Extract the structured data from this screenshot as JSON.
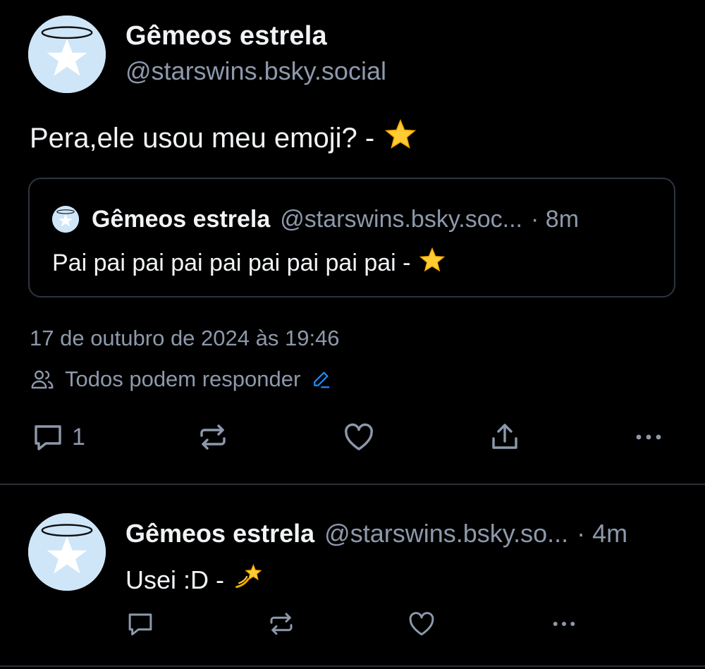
{
  "post": {
    "author_name": "Gêmeos estrela",
    "author_handle": "@starswins.bsky.social",
    "text": "Pera,ele usou meu emoji? -",
    "emoji": "⭐",
    "quote": {
      "author_name": "Gêmeos estrela",
      "author_handle": "@starswins.bsky.soc...",
      "time": "· 8m",
      "text": "Pai pai pai pai pai pai pai pai pai  -",
      "emoji": "⭐"
    },
    "timestamp": "17 de outubro de 2024 às 19:46",
    "reply_setting": "Todos podem responder",
    "actions": {
      "reply_count": "1",
      "reply_icon": "comment-icon",
      "repost_icon": "repost-icon",
      "like_icon": "heart-icon",
      "share_icon": "share-icon",
      "more_icon": "more-icon"
    }
  },
  "reply": {
    "author_name": "Gêmeos estrela",
    "author_handle": "@starswins.bsky.so...",
    "time": "· 4m",
    "text": "Usei :D -",
    "emoji": "💫"
  },
  "colors": {
    "background": "#000000",
    "text": "#f1f3f5",
    "muted": "#8d99ab",
    "accent": "#208bfe",
    "border": "#2e3440",
    "avatar_bg": "#cfe6f8"
  }
}
